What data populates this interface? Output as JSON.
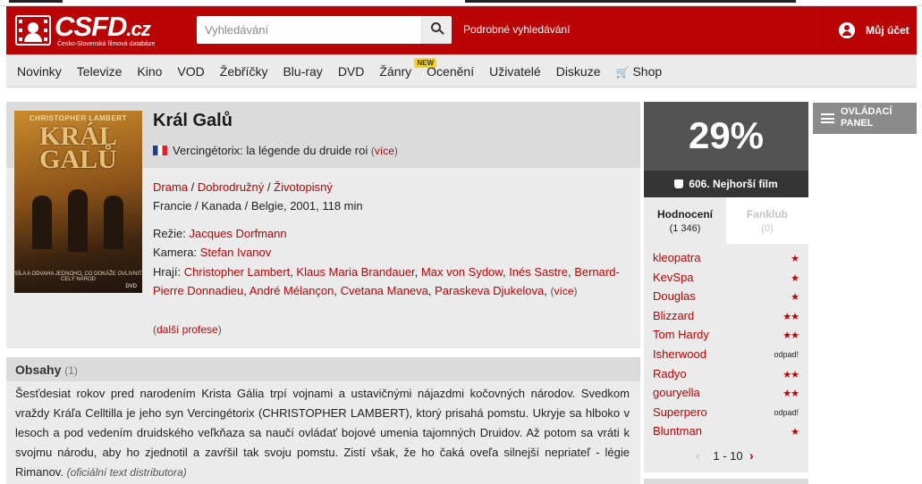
{
  "header": {
    "logo_text": "CSFD",
    "logo_suffix": ".cz",
    "logo_tagline": "Česko-Slovenská filmová databáze",
    "search_placeholder": "Vyhledávání",
    "advanced_search": "Podrobné vyhledávání",
    "account": "Můj účet"
  },
  "nav": {
    "items": [
      "Novinky",
      "Televize",
      "Kino",
      "VOD",
      "Žebříčky",
      "Blu-ray",
      "DVD",
      "Žánry",
      "Ocenění",
      "Uživatelé",
      "Diskuze",
      "Shop"
    ],
    "new_badge": "NEW"
  },
  "movie": {
    "title": "Král Galů",
    "original_title": "Vercingétorix: la légende du druide roi",
    "more": "více",
    "genres": [
      "Drama",
      "Dobrodružný",
      "Životopisný"
    ],
    "origin": "Francie / Kanada / Belgie, 2001, 118 min",
    "director_label": "Režie:",
    "director": "Jacques Dorfmann",
    "camera_label": "Kamera:",
    "camera": "Stefan Ivanov",
    "cast_label": "Hrají:",
    "cast": [
      "Christopher Lambert",
      "Klaus Maria Brandauer",
      "Max von Sydow",
      "Inés Sastre",
      "Bernard-Pierre Donnadieu",
      "André Mélançon",
      "Cvetana Maneva",
      "Paraskeva Djukelova"
    ],
    "more_professions": "další profese",
    "poster": {
      "top": "CHRISTOPHER LAMBERT",
      "title": "KRÁL GALŮ",
      "bottom": "SÍLA A ODVAHA JEDNOHO, CO DOKÁŽE OVLIVNIT CELÝ NÁROD",
      "logo": "DVD"
    }
  },
  "plot": {
    "heading": "Obsahy",
    "count": "(1)",
    "text": "Šesťdesiat rokov pred narodením Krista Gália trpí vojnami a ustavičnými nájazdmi kočovných národov. Svedkom vraždy Kráľa Celltilla je jeho syn Vercingétorix (CHRISTOPHER LAMBERT), ktorý prisahá pomstu. Ukryje sa hlboko v lesoch a pod vedením druidského veľkňaza sa naučí ovládať bojové umenia tajomných Druidov. Až potom sa vráti k svojmu národu, aby ho zjednotil a zavŕšil tak svoju pomstu. Zistí však, že ho čaká oveľa silnejší nepriateľ - légie Rimanov.",
    "source": "(oficiální text distributora)"
  },
  "rating": {
    "percent": "29%",
    "worst": "606. Nejhorší film",
    "tabs": [
      {
        "label": "Hodnocení",
        "count": "(1 346)"
      },
      {
        "label": "Fanklub",
        "count": "(0)"
      }
    ],
    "users": [
      {
        "name": "kleopatra",
        "score": "★"
      },
      {
        "name": "KevSpa",
        "score": "★"
      },
      {
        "name": "Douglas",
        "score": "★"
      },
      {
        "name": "Blizzard",
        "score": "★★"
      },
      {
        "name": "Tom Hardy",
        "score": "★★"
      },
      {
        "name": "Isherwood",
        "score": "odpad!"
      },
      {
        "name": "Radyo",
        "score": "★★"
      },
      {
        "name": "gouryella",
        "score": "★★"
      },
      {
        "name": "Superpero",
        "score": "odpad!"
      },
      {
        "name": "Bluntman",
        "score": "★"
      }
    ],
    "pager": "1 - 10",
    "prev": "‹",
    "next": "›"
  },
  "control_panel": {
    "label": "OVLÁDACÍ PANEL"
  },
  "colors": {
    "brand": "#ba0305",
    "rating_box": "#535353",
    "worst_bar": "#343434"
  }
}
